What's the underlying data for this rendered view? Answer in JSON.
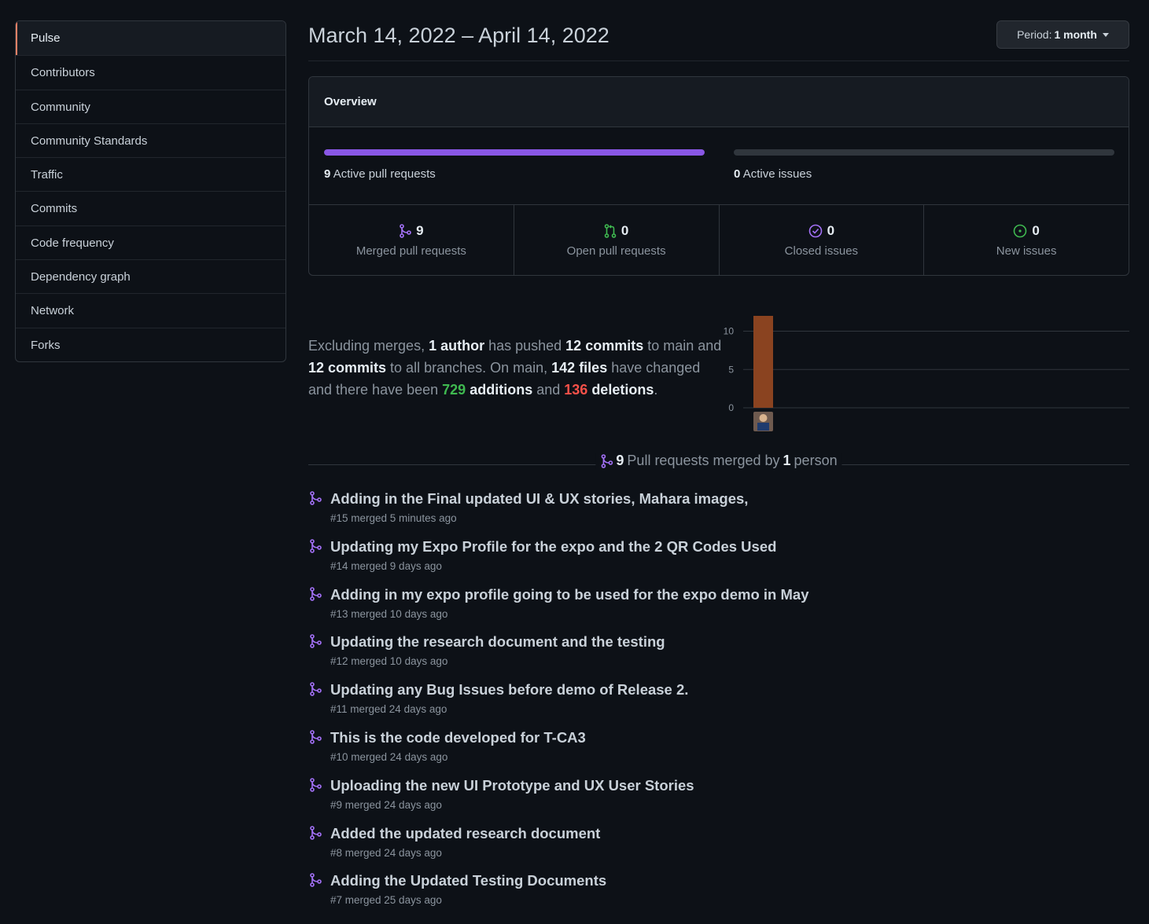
{
  "sidebar": {
    "items": [
      {
        "label": "Pulse"
      },
      {
        "label": "Contributors"
      },
      {
        "label": "Community"
      },
      {
        "label": "Community Standards"
      },
      {
        "label": "Traffic"
      },
      {
        "label": "Commits"
      },
      {
        "label": "Code frequency"
      },
      {
        "label": "Dependency graph"
      },
      {
        "label": "Network"
      },
      {
        "label": "Forks"
      }
    ]
  },
  "header": {
    "date_range": "March 14, 2022 – April 14, 2022",
    "period_prefix": "Period:",
    "period_value": "1 month"
  },
  "overview": {
    "title": "Overview",
    "prs_bar": {
      "count": "9",
      "label": "Active pull requests",
      "fill_fraction": 1.0,
      "color": "#8957e5"
    },
    "issues_bar": {
      "count": "0",
      "label": "Active issues",
      "fill_fraction": 0.0,
      "color": "#238636"
    },
    "stats": [
      {
        "count": "9",
        "label": "Merged pull requests",
        "icon": "merge-icon"
      },
      {
        "count": "0",
        "label": "Open pull requests",
        "icon": "pull-request-icon"
      },
      {
        "count": "0",
        "label": "Closed issues",
        "icon": "check-circle-icon"
      },
      {
        "count": "0",
        "label": "New issues",
        "icon": "issue-open-icon"
      }
    ]
  },
  "summary": {
    "t1": "Excluding merges, ",
    "authors": "1 author",
    "t2": " has pushed ",
    "commits_main": "12 commits",
    "t3": " to main and ",
    "commits_all": "12 commits",
    "t4": " to all branches. On main, ",
    "files": "142 files",
    "t5": " have changed and there have been ",
    "additions_num": "729",
    "additions_word": "additions",
    "t6": " and ",
    "deletions_num": "136",
    "deletions_word": "deletions",
    "t7": "."
  },
  "chart_data": {
    "type": "bar",
    "categories": [
      ""
    ],
    "values": [
      12
    ],
    "ylim": [
      0,
      12
    ],
    "yticks": [
      "10",
      "5",
      "0"
    ],
    "color": "#8a4320"
  },
  "pr_section": {
    "count": "9",
    "mid_text": "Pull requests merged by",
    "people": "1",
    "end_text": "person"
  },
  "pull_requests": [
    {
      "title": "Adding in the Final updated UI & UX stories, Mahara images,",
      "meta": "#15 merged 5 minutes ago"
    },
    {
      "title": "Updating my Expo Profile for the expo and the 2 QR Codes Used",
      "meta": "#14 merged 9 days ago"
    },
    {
      "title": "Adding in my expo profile going to be used for the expo demo in May",
      "meta": "#13 merged 10 days ago"
    },
    {
      "title": "Updating the research document and the testing",
      "meta": "#12 merged 10 days ago"
    },
    {
      "title": "Updating any Bug Issues before demo of Release 2.",
      "meta": "#11 merged 24 days ago"
    },
    {
      "title": "This is the code developed for T-CA3",
      "meta": "#10 merged 24 days ago"
    },
    {
      "title": "Uploading the new UI Prototype and UX User Stories",
      "meta": "#9 merged 24 days ago"
    },
    {
      "title": "Added the updated research document",
      "meta": "#8 merged 24 days ago"
    },
    {
      "title": "Adding the Updated Testing Documents",
      "meta": "#7 merged 25 days ago"
    }
  ]
}
